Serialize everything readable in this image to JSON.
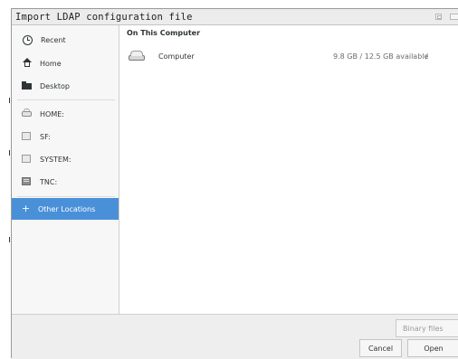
{
  "window": {
    "title": "Import LDAP configuration file"
  },
  "sidebar": {
    "items": [
      {
        "label": "Recent",
        "icon": "clock-icon"
      },
      {
        "label": "Home",
        "icon": "home-icon"
      },
      {
        "label": "Desktop",
        "icon": "folder-icon"
      },
      {
        "label": "HOME:",
        "icon": "drive-icon"
      },
      {
        "label": "SF:",
        "icon": "disk-icon"
      },
      {
        "label": "SYSTEM:",
        "icon": "disk-icon"
      },
      {
        "label": "TNC:",
        "icon": "disk-icon"
      },
      {
        "label": "Other Locations",
        "icon": "plus-icon",
        "active": true
      }
    ]
  },
  "main": {
    "section_title": "On This Computer",
    "locations": [
      {
        "name": "Computer",
        "space": "9.8 GB / 12.5 GB available",
        "path": "/"
      }
    ]
  },
  "footer": {
    "filter_label": "Binary files",
    "cancel_label": "Cancel",
    "open_label": "Open"
  },
  "colors": {
    "accent": "#4a90d9",
    "text": "#2e3436"
  }
}
